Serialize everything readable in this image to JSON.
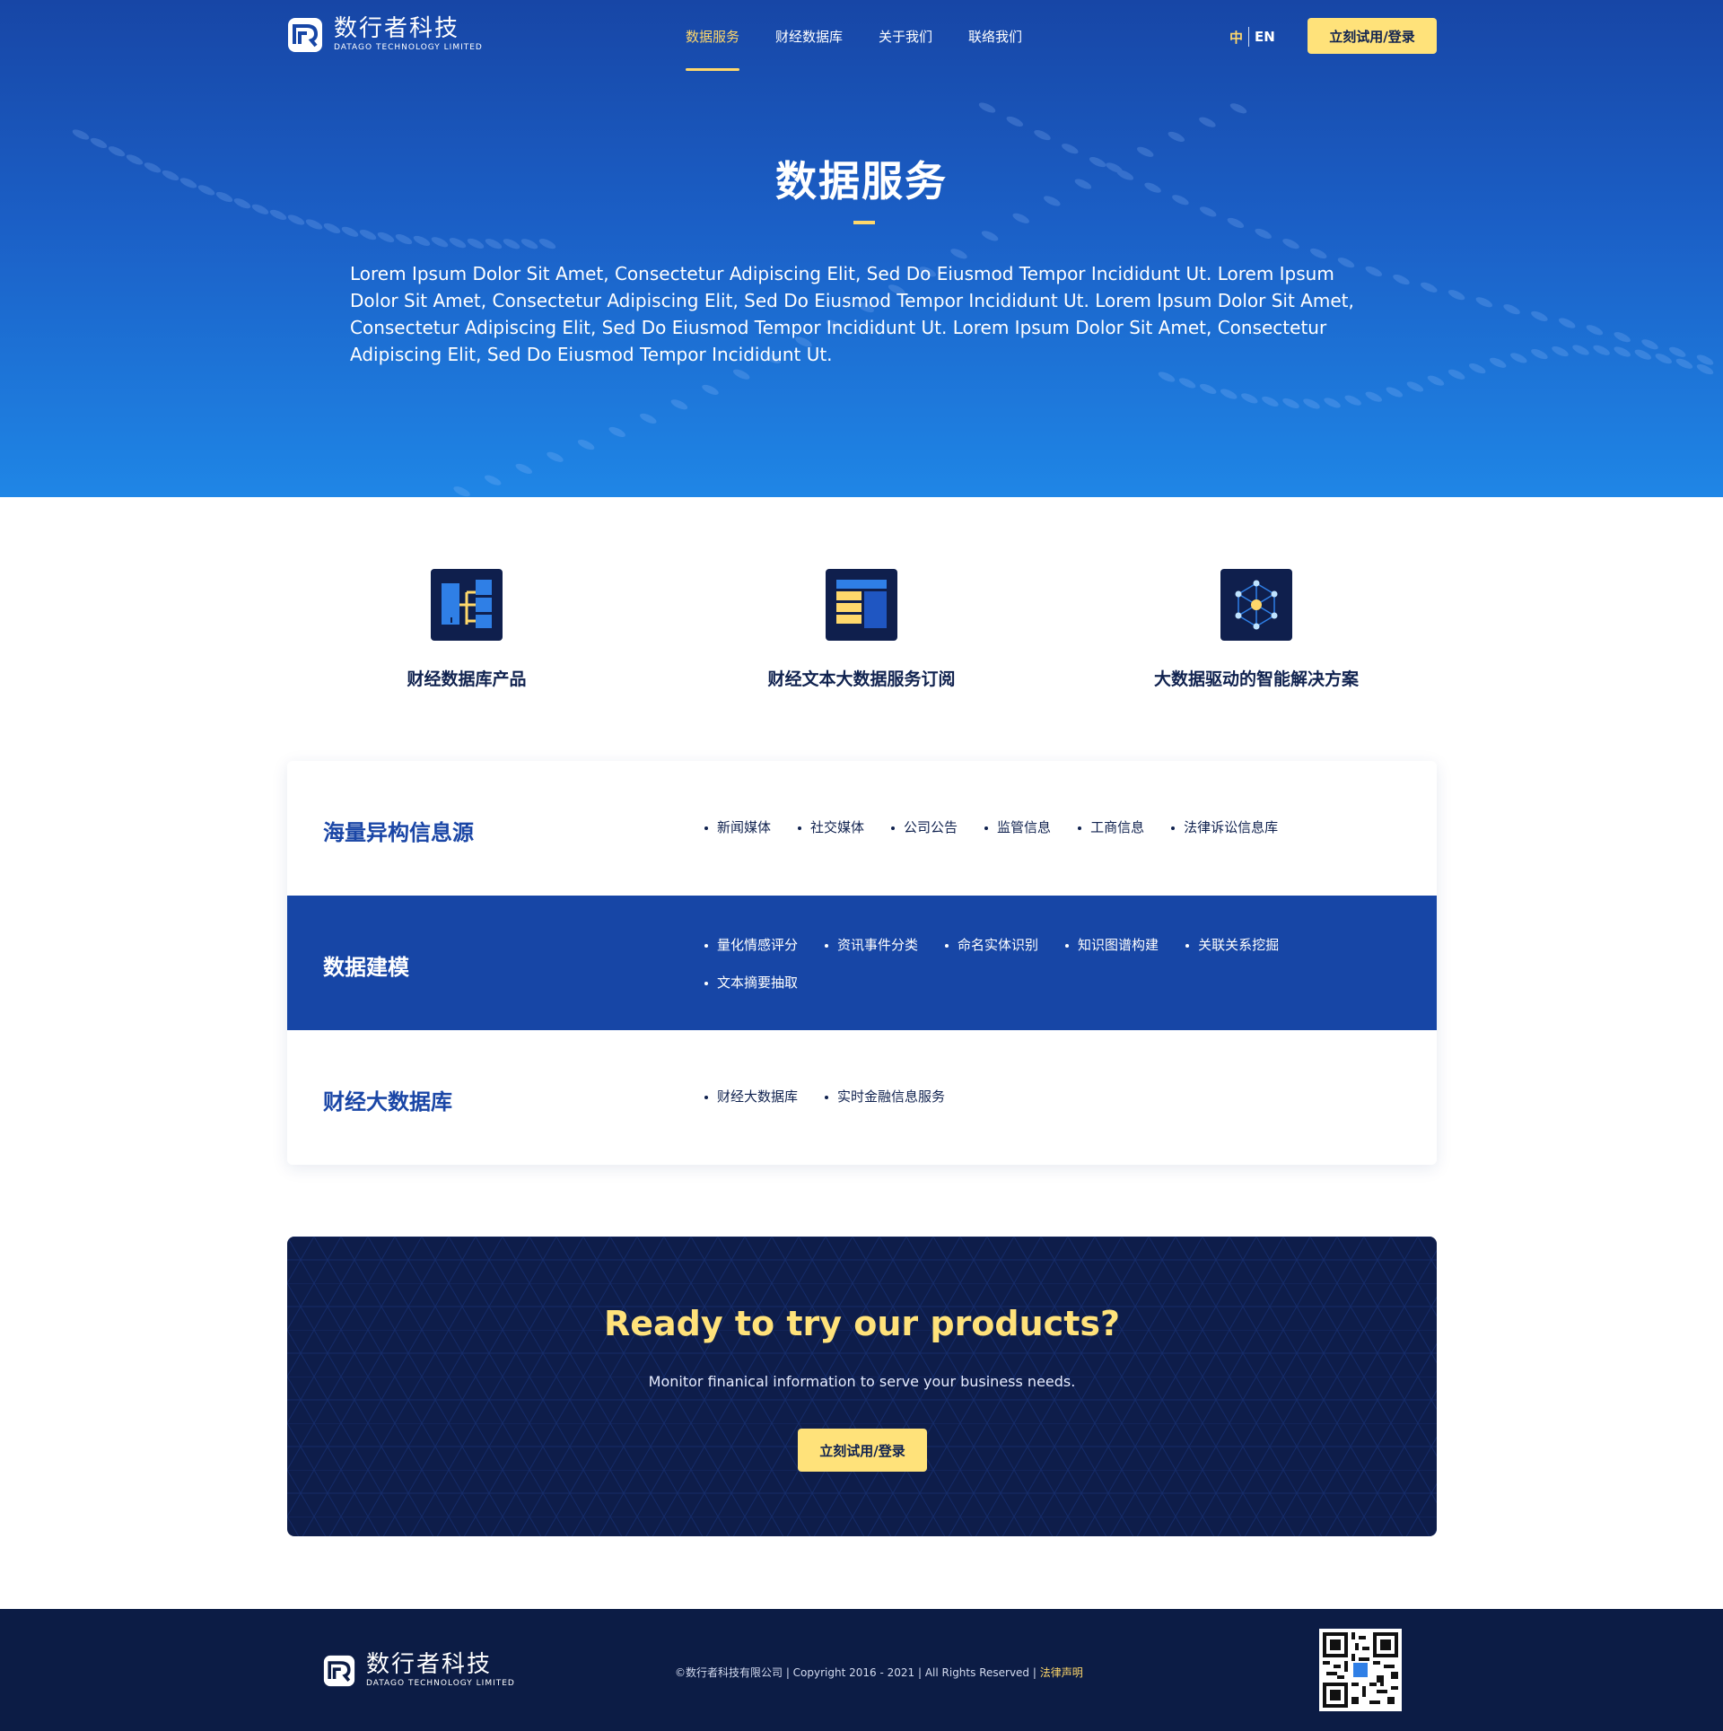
{
  "brand": {
    "name_cn": "数行者科技",
    "name_en": "DATAGO TECHNOLOGY LIMITED",
    "primary_color": "#1746a6",
    "accent_color": "#ffe27a",
    "dark_color": "#0e1d4a"
  },
  "nav": {
    "items": [
      {
        "label": "数据服务",
        "active": true
      },
      {
        "label": "财经数据库",
        "active": false
      },
      {
        "label": "关于我们",
        "active": false
      },
      {
        "label": "联络我们",
        "active": false
      }
    ],
    "lang_zh": "中",
    "lang_en": "EN",
    "cta_label": "立刻试用/登录"
  },
  "hero": {
    "title": "数据服务",
    "description": "Lorem Ipsum Dolor Sit Amet, Consectetur Adipiscing Elit, Sed Do Eiusmod Tempor Incididunt Ut. Lorem Ipsum Dolor Sit Amet, Consectetur Adipiscing Elit, Sed Do Eiusmod Tempor Incididunt Ut. Lorem Ipsum Dolor Sit Amet, Consectetur Adipiscing Elit, Sed Do Eiusmod Tempor Incididunt Ut. Lorem Ipsum Dolor Sit Amet, Consectetur Adipiscing Elit, Sed Do Eiusmod Tempor Incididunt Ut."
  },
  "features": [
    {
      "label": "财经数据库产品",
      "icon": "database-structure-icon"
    },
    {
      "label": "财经文本大数据服务订阅",
      "icon": "document-layout-icon"
    },
    {
      "label": "大数据驱动的智能解决方案",
      "icon": "network-cube-icon"
    }
  ],
  "rows": [
    {
      "title": "海量异构信息源",
      "tags": [
        "新闻媒体",
        "社交媒体",
        "公司公告",
        "监管信息",
        "工商信息",
        "法律诉讼信息库"
      ]
    },
    {
      "title": "数据建模",
      "tags": [
        "量化情感评分",
        "资讯事件分类",
        "命名实体识别",
        "知识图谱构建",
        "关联关系挖掘",
        "文本摘要抽取"
      ]
    },
    {
      "title": "财经大数据库",
      "tags": [
        "财经大数据库",
        "实时金融信息服务"
      ]
    }
  ],
  "cta": {
    "title": "Ready to try our products?",
    "subtitle": "Monitor finanical information to serve your business needs.",
    "button_label": "立刻试用/登录"
  },
  "footer": {
    "copyright": "©数行者科技有限公司 | Copyright 2016 - 2021 | All Rights Reserved | ",
    "legal_link": "法律声明"
  }
}
